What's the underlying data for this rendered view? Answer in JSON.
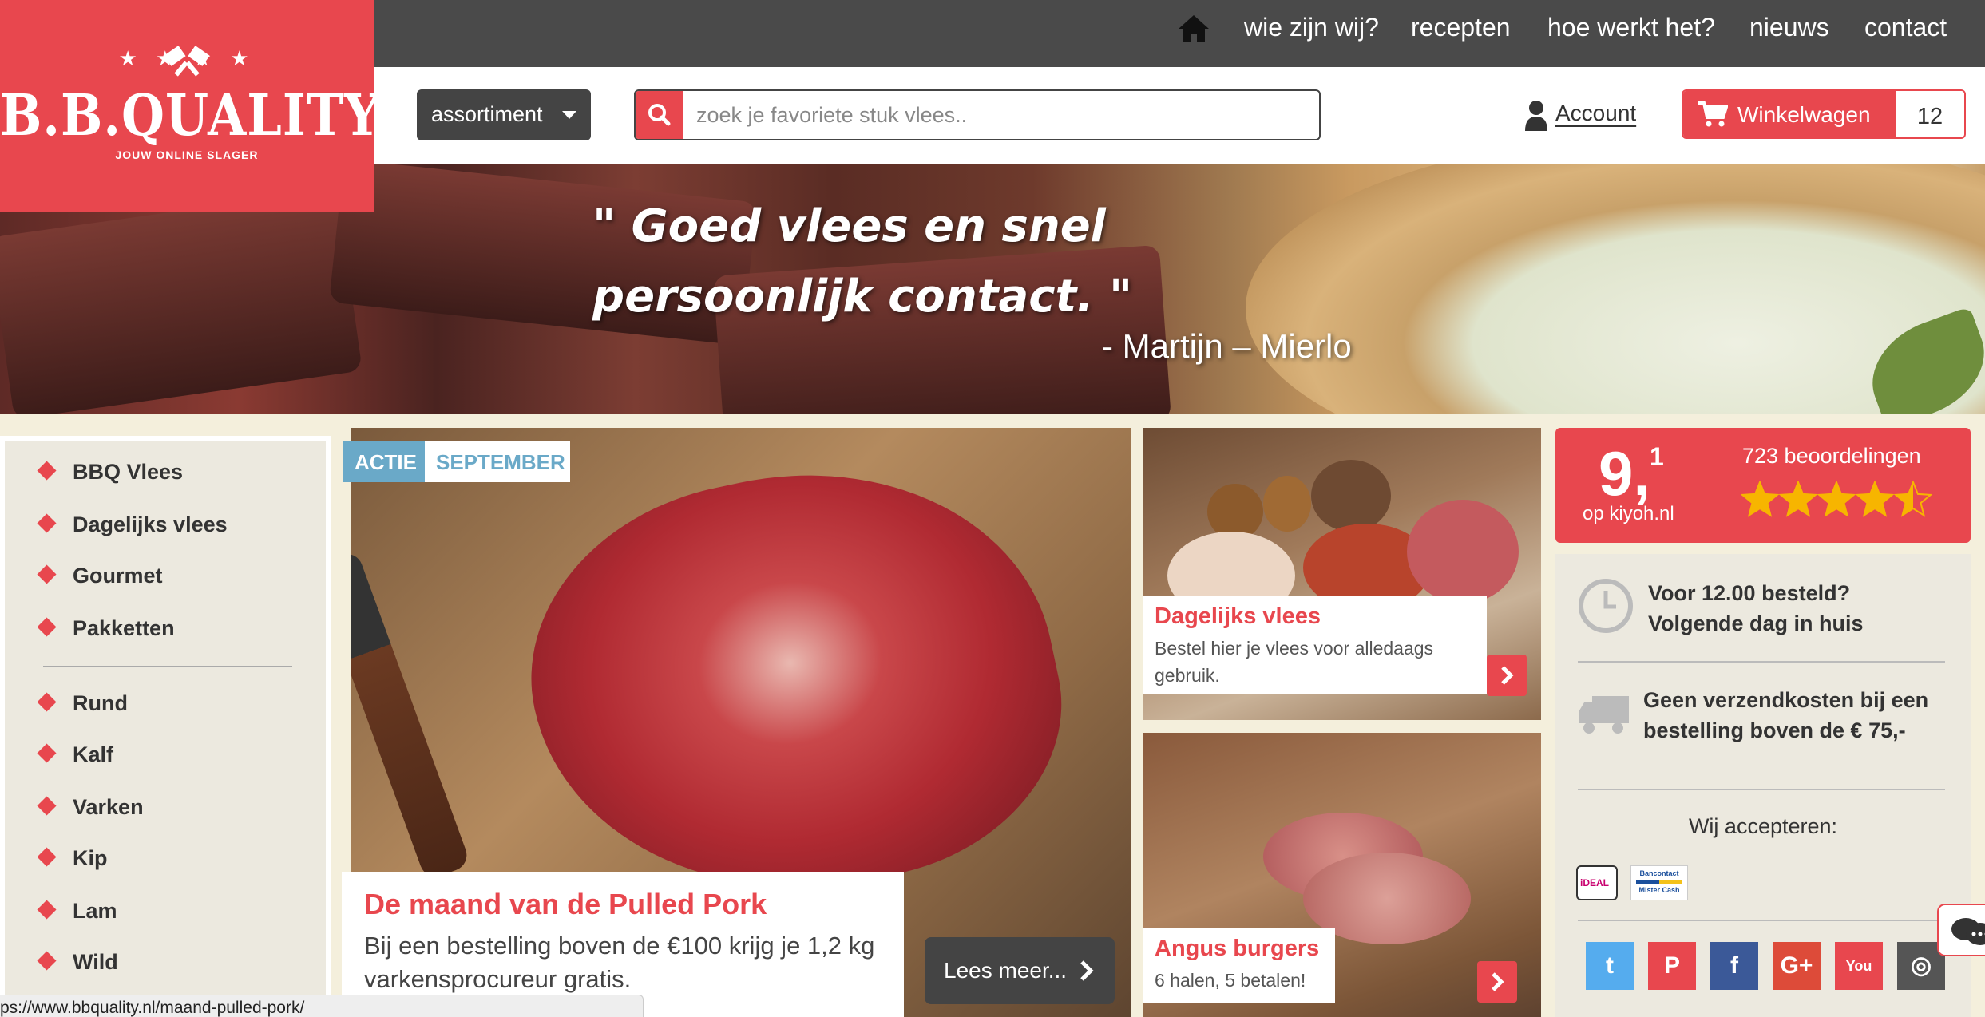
{
  "topnav": {
    "home_icon": "home-icon",
    "items": [
      "wie zijn wij?",
      "recepten",
      "hoe werkt het?",
      "nieuws",
      "contact"
    ]
  },
  "logo": {
    "name": "B.B.QUALITY",
    "tagline": "JOUW ONLINE SLAGER",
    "stars": "★ ★ ★ ★"
  },
  "header": {
    "assortiment_label": "assortiment",
    "search_placeholder": "zoek je favoriete stuk vlees..",
    "account_label": "Account",
    "cart_label": "Winkelwagen",
    "cart_count": "12"
  },
  "hero": {
    "quote": "\" Goed vlees en snel persoonlijk contact. \"",
    "author": "- Martijn – Mierlo"
  },
  "sidebar": {
    "group1": [
      "BBQ Vlees",
      "Dagelijks vlees",
      "Gourmet",
      "Pakketten"
    ],
    "group2": [
      "Rund",
      "Kalf",
      "Varken",
      "Kip",
      "Lam",
      "Wild"
    ]
  },
  "feature": {
    "badge_action": "ACTIE",
    "badge_month": "SEPTEMBER",
    "title": "De maand van de Pulled Pork",
    "description": "Bij een bestelling boven de €100 krijg je 1,2 kg varkensprocureur gratis.",
    "button": "Lees meer..."
  },
  "tiles": [
    {
      "title": "Dagelijks vlees",
      "description": "Bestel hier je vlees voor alledaags gebruik."
    },
    {
      "title": "Angus burgers",
      "description": "6 halen, 5 betalen!"
    }
  ],
  "rating": {
    "score_main": "9,",
    "score_decimal": "1",
    "source": "op kiyoh.nl",
    "reviews": "723 beoordelingen",
    "stars": 4.5,
    "stars_max": 5
  },
  "info": {
    "delivery": "Voor 12.00 besteld? Volgende dag in huis",
    "shipping": "Geen verzendkosten bij een bestelling boven de € 75,-",
    "accept_label": "Wij accepteren:",
    "payment_logos": [
      "ideal-logo",
      "bancontact-logo"
    ],
    "payment_logo_text": [
      "iDEAL",
      "Bancontact",
      "Mister Cash"
    ]
  },
  "social": [
    {
      "name": "twitter-icon",
      "glyph": "t",
      "color": "#55acee"
    },
    {
      "name": "pinterest-icon",
      "glyph": "P",
      "color": "#e8474e"
    },
    {
      "name": "facebook-icon",
      "glyph": "f",
      "color": "#3b5998"
    },
    {
      "name": "googleplus-icon",
      "glyph": "G+",
      "color": "#dd4b39"
    },
    {
      "name": "youtube-icon",
      "glyph": "You",
      "color": "#e8474e"
    },
    {
      "name": "instagram-icon",
      "glyph": "◎",
      "color": "#555"
    }
  ],
  "status_url": "ps://www.bbquality.nl/maand-pulled-pork/",
  "colors": {
    "brand": "#e8474e",
    "dark": "#4a4a4a",
    "accent_blue": "#6aa9c8"
  }
}
